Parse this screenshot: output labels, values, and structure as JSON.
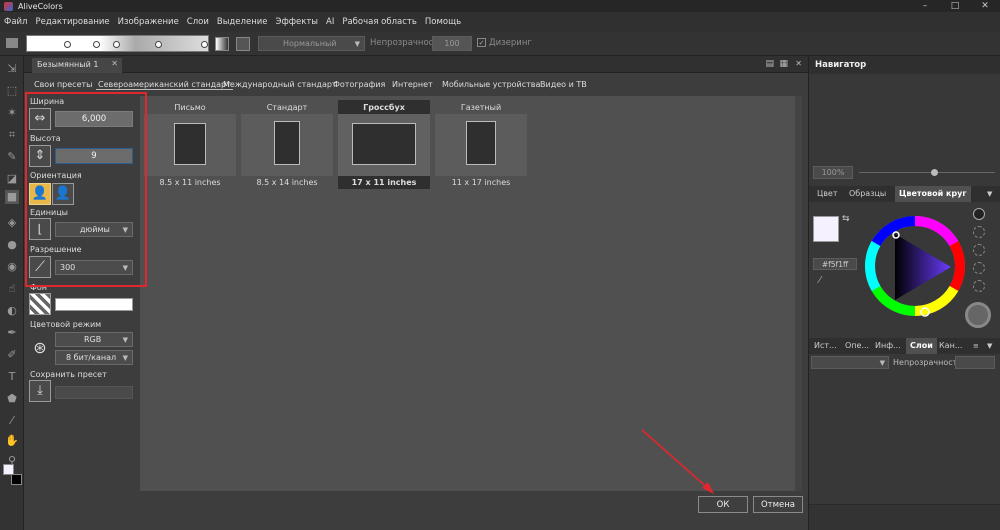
{
  "app": {
    "title": "AliveColors",
    "win_min": "–",
    "win_max": "□",
    "win_close": "✕"
  },
  "menu": [
    "Файл",
    "Редактирование",
    "Изображение",
    "Слои",
    "Выделение",
    "Эффекты",
    "AI",
    "Рабочая область",
    "Помощь"
  ],
  "options_bar": {
    "blend_mode": "Нормальный",
    "opacity_label": "Непрозрачность",
    "opacity_value": "100",
    "dither_label": "Дизеринг"
  },
  "document_tab": {
    "title": "Безымянный 1"
  },
  "preset_tabs": [
    "Свои пресеты",
    "Североамериканский стандарт",
    "Международный стандарт",
    "Фотография",
    "Интернет",
    "Мобильные устройства",
    "Видео и ТВ"
  ],
  "active_preset_tab": "Североамериканский стандарт",
  "settings": {
    "width_label": "Ширина",
    "width_value": "6,000",
    "height_label": "Высота",
    "height_value": "9",
    "orientation_label": "Ориентация",
    "units_label": "Единицы",
    "units_value": "дюймы",
    "resolution_label": "Разрешение",
    "resolution_value": "300",
    "background_label": "Фон",
    "color_mode_label": "Цветовой режим",
    "color_mode_value": "RGB",
    "bit_depth_value": "8 бит/канал",
    "save_preset_label": "Сохранить пресет"
  },
  "presets": [
    {
      "name": "Письмо",
      "size": "8.5 x 11 inches",
      "selected": false
    },
    {
      "name": "Стандарт",
      "size": "8.5 x 14 inches",
      "selected": false
    },
    {
      "name": "Гроссбух",
      "size": "17 x 11 inches",
      "selected": true
    },
    {
      "name": "Газетный",
      "size": "11 x 17 inches",
      "selected": false
    }
  ],
  "buttons": {
    "ok": "ОК",
    "cancel": "Отмена"
  },
  "right_panel": {
    "navigator_title": "Навигатор",
    "zoom_value": "100%",
    "color_tabs": [
      "Цвет",
      "Образцы",
      "Цветовой круг"
    ],
    "active_color_tab": "Цветовой круг",
    "hex_value": "#f5f1ff",
    "layer_tabs": [
      "Ист...",
      "Опе...",
      "Инф...",
      "Слои",
      "Кан..."
    ],
    "active_layer_tab": "Слои",
    "opacity_label": "Непрозрачность",
    "fg_color": "#f5f1ff",
    "bg_color": "#000000"
  },
  "colors": {
    "accent": "#e1262c",
    "selected_card": "#2f2f2f"
  }
}
